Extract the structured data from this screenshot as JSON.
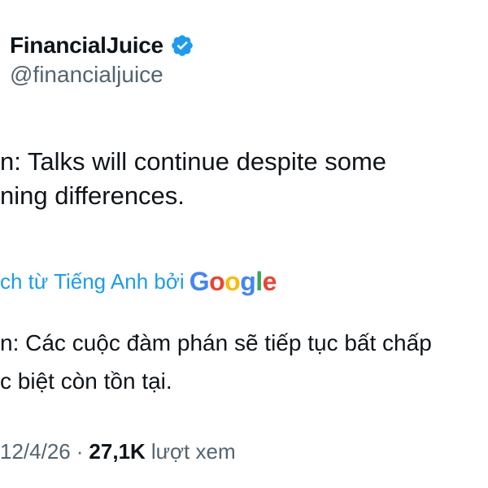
{
  "author": {
    "name": "FinancialJuice",
    "handle": "@financialjuice",
    "verified_icon": "verified-badge-icon",
    "verified_color": "#1d9bf0"
  },
  "tweet": {
    "lines": [
      "n: Talks will continue despite some",
      "ning differences."
    ]
  },
  "translation": {
    "label": "ch từ Tiếng Anh bởi",
    "provider": "Google",
    "lines": [
      "n: Các cuộc đàm phán sẽ tiếp tục bất chấp",
      "c biệt còn tồn tại."
    ]
  },
  "meta": {
    "date": "12/4/26",
    "separator": "·",
    "views_count": "27,1K",
    "views_label": "lượt xem"
  },
  "colors": {
    "text": "#0f1419",
    "secondary": "#536471",
    "accent": "#1d9bf0"
  }
}
